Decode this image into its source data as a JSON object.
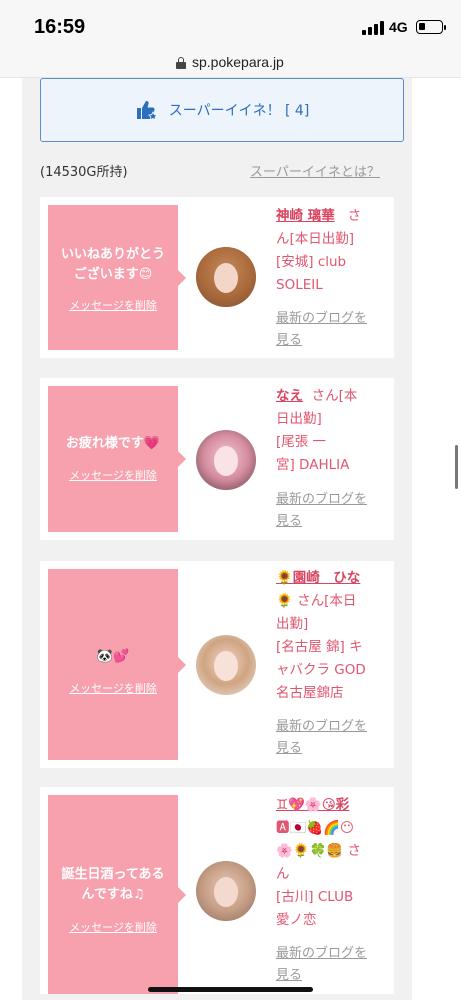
{
  "status_bar": {
    "time": "16:59",
    "network": "4G"
  },
  "browser": {
    "url": "sp.pokepara.jp"
  },
  "super_like": {
    "label": "スーパーイイネ！ [ 4]"
  },
  "holding": "(14530G所持)",
  "what_link": "スーパーイイネとは？",
  "delete_label": "メッセージを削除",
  "blog_label": [
    "最新のブログを",
    "見る"
  ],
  "cards": [
    {
      "message": [
        "いいねありがとう",
        "ございます😊"
      ],
      "name": "神崎 璃華",
      "info": [
        "さ",
        "ん[本日出勤]",
        "[安城] club",
        "SOLEIL"
      ]
    },
    {
      "message": [
        "お疲れ様です💗"
      ],
      "name": "なえ",
      "info": [
        "さん[本",
        "日出勤]",
        "[尾張 一",
        "宮] DAHLIA"
      ]
    },
    {
      "message": [
        "🐼💕"
      ],
      "name": "🌻園崎　ひな",
      "info": [
        "🌻 さん[本日",
        "出勤]",
        "[名古屋 錦] キ",
        "ャバクラ GOD",
        "名古屋錦店"
      ]
    },
    {
      "message": [
        "誕生日酒ってある",
        "んですね♫"
      ],
      "name": "♊💖🌸😘彩",
      "info": [
        "🅰🇯🇵🍓🌈😶",
        "🌸🌻🍀🍔 さ",
        "ん",
        "[古川] CLUB",
        "愛ノ恋"
      ]
    }
  ]
}
